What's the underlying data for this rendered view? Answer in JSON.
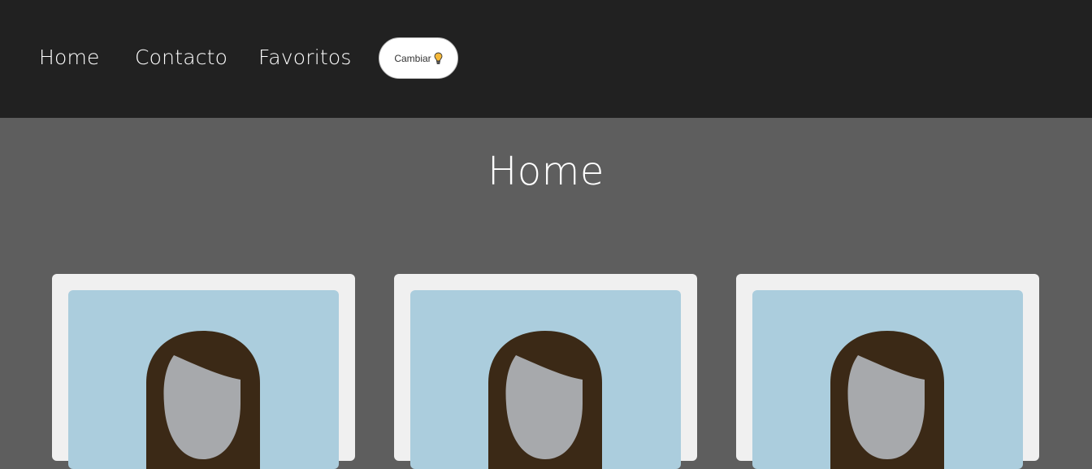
{
  "nav": {
    "links": [
      "Home",
      "Contacto",
      "Favoritos"
    ],
    "toggle_label": "Cambiar"
  },
  "page": {
    "title": "Home"
  },
  "cards": [
    {
      "image": "avatar-placeholder"
    },
    {
      "image": "avatar-placeholder"
    },
    {
      "image": "avatar-placeholder"
    }
  ],
  "colors": {
    "navbar_bg": "#212121",
    "page_bg": "#5e5e5e",
    "card_bg": "#f0f0f0",
    "card_image_bg": "#abcddd",
    "hair": "#3b2916",
    "face": "#a7a9ac",
    "bulb": "#f5b93a"
  }
}
